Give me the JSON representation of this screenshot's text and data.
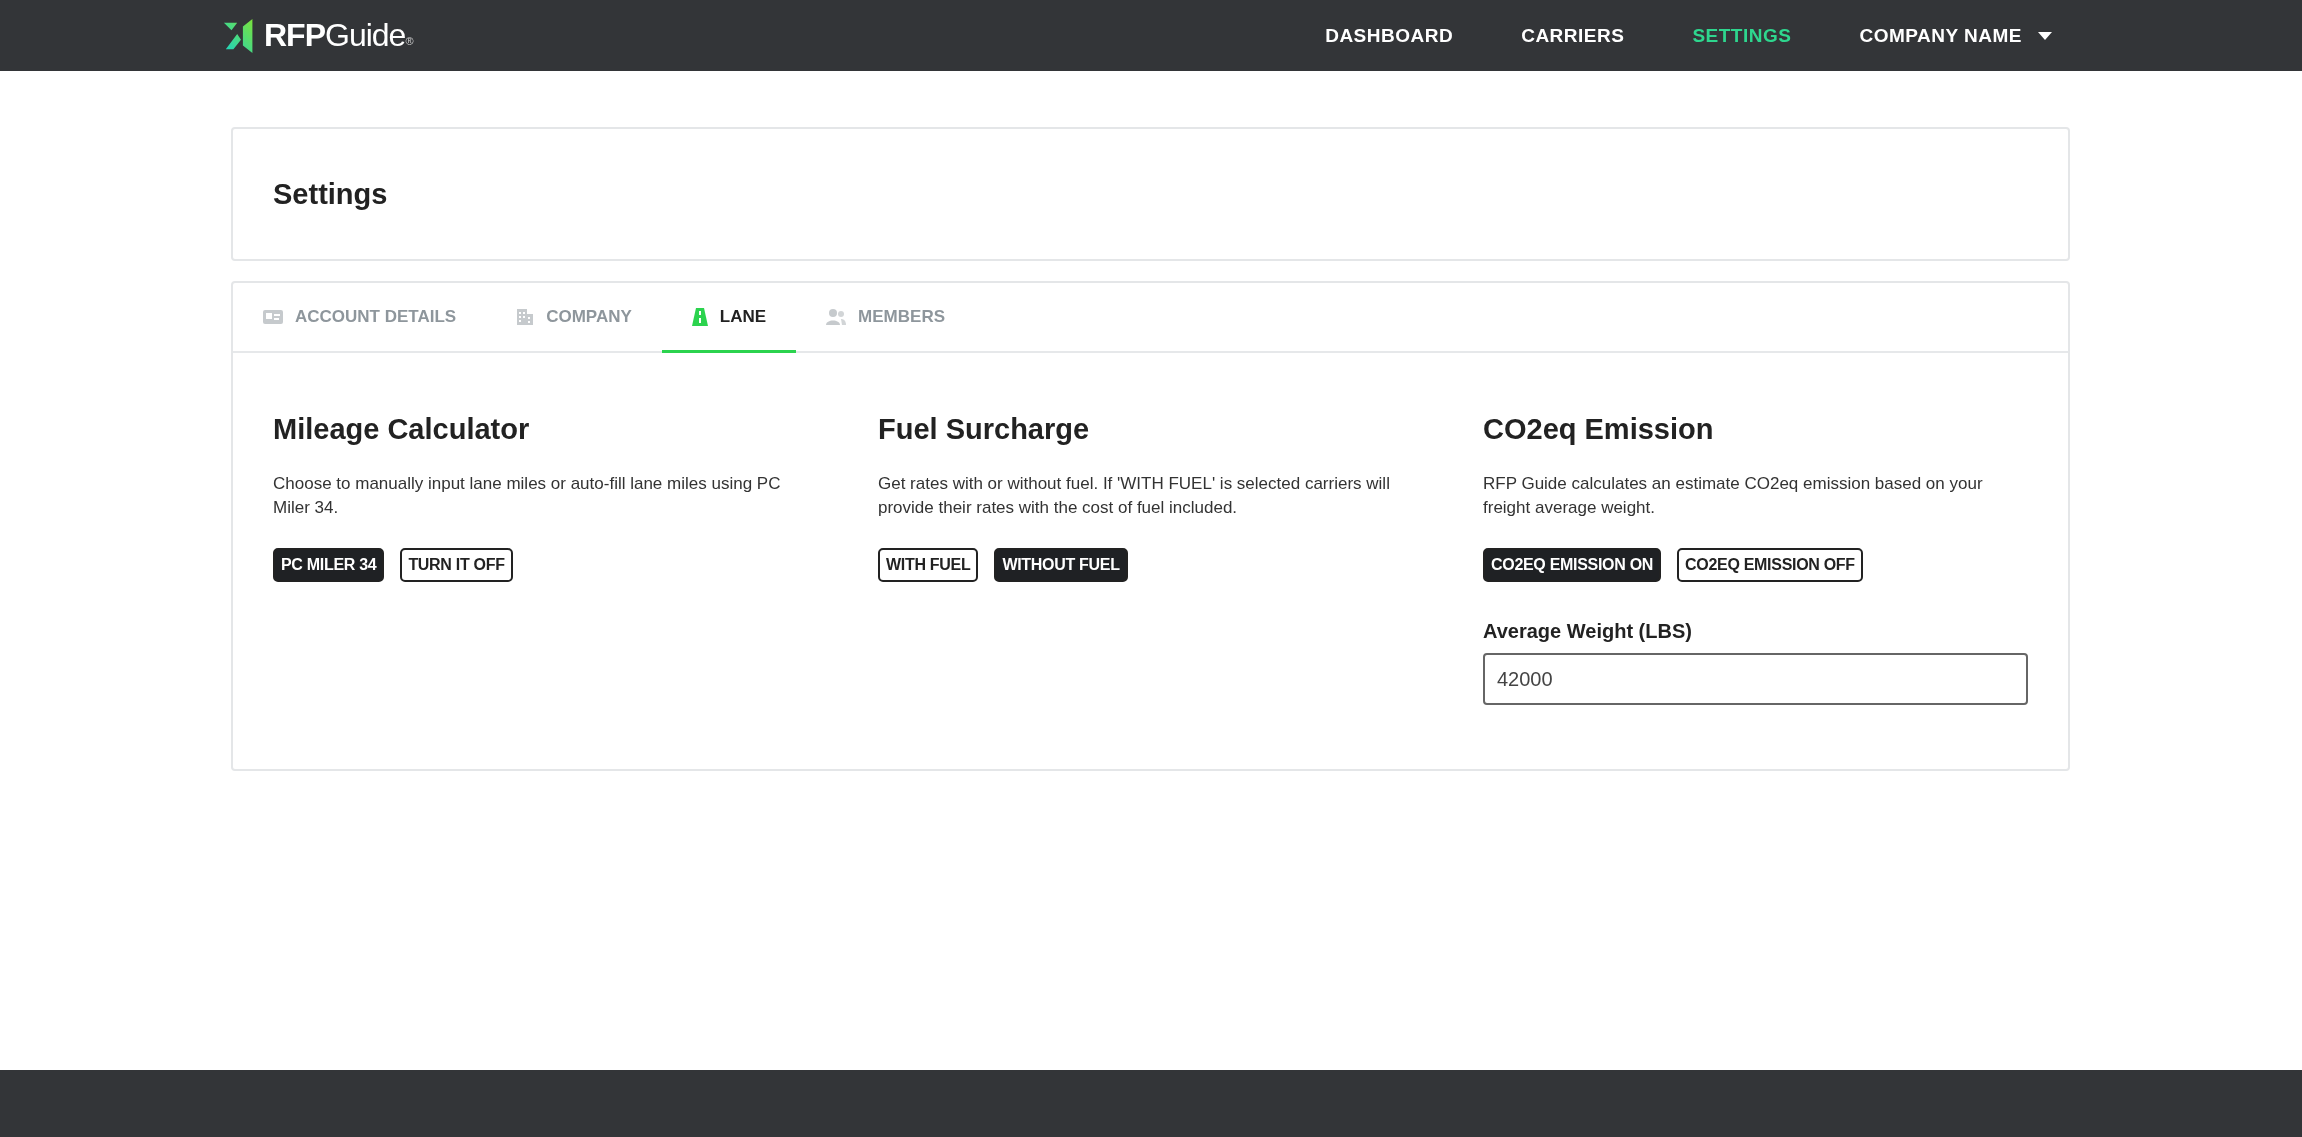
{
  "header": {
    "logo": {
      "bold": "RFP",
      "light": "Guide",
      "mark": "®"
    },
    "nav": [
      {
        "label": "DASHBOARD",
        "selected": false
      },
      {
        "label": "CARRIERS",
        "selected": false
      },
      {
        "label": "SETTINGS",
        "selected": true
      }
    ],
    "account_menu": {
      "label": "COMPANY NAME"
    }
  },
  "page_title": "Settings",
  "tabs": [
    {
      "label": "ACCOUNT DETAILS",
      "selected": false
    },
    {
      "label": "COMPANY",
      "selected": false
    },
    {
      "label": "LANE",
      "selected": true
    },
    {
      "label": "MEMBERS",
      "selected": false
    }
  ],
  "sections": [
    {
      "title": "Mileage Calculator",
      "description": "Choose to manually input lane miles or auto-fill lane miles using PC Miler 34.",
      "options": [
        {
          "label": "PC MILER 34",
          "selected": true
        },
        {
          "label": "TURN IT OFF",
          "selected": false
        }
      ]
    },
    {
      "title": "Fuel Surcharge",
      "description": "Get rates with or without fuel. If 'WITH FUEL' is selected carriers will provide their rates with the cost of fuel included.",
      "options": [
        {
          "label": "WITH FUEL",
          "selected": false
        },
        {
          "label": "WITHOUT FUEL",
          "selected": true
        }
      ]
    },
    {
      "title": "CO2eq Emission",
      "description": "RFP Guide calculates an estimate CO2eq emission based on your freight average weight.",
      "options": [
        {
          "label": "CO2EQ EMISSION ON",
          "selected": true
        },
        {
          "label": "CO2EQ EMISSION OFF",
          "selected": false
        }
      ],
      "field": {
        "label": "Average Weight (LBS)",
        "value": "42000"
      }
    }
  ]
}
